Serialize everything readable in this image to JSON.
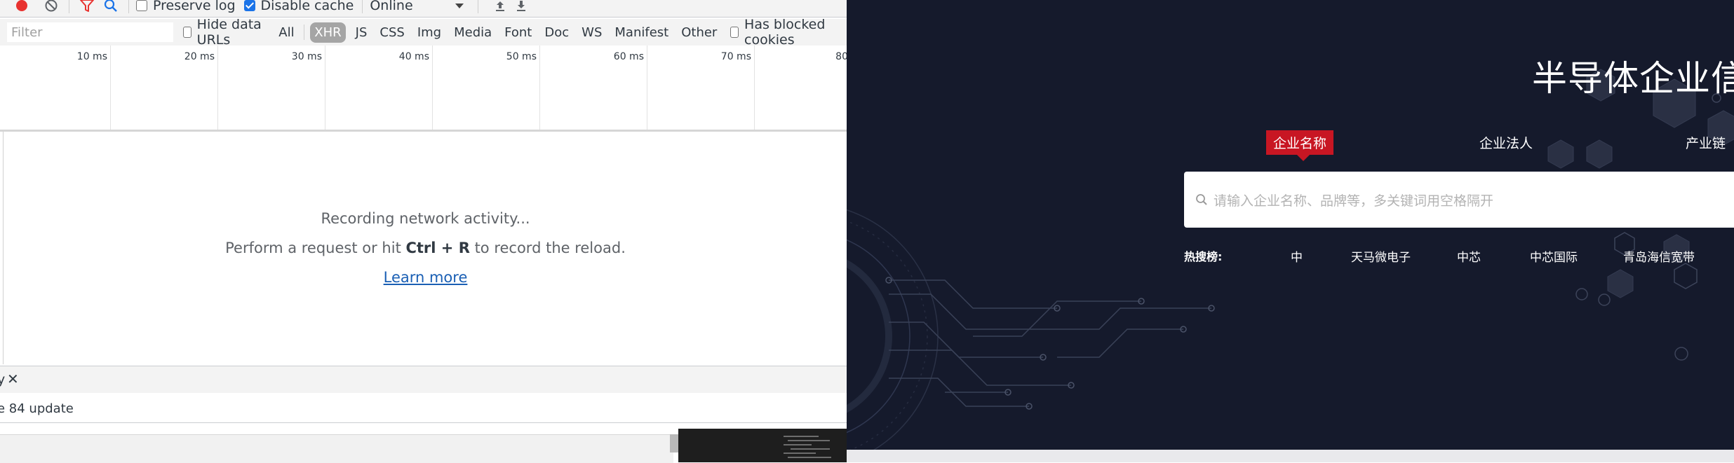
{
  "devtools": {
    "toolbar": {
      "preserve_log_label": "Preserve log",
      "preserve_log_checked": false,
      "disable_cache_label": "Disable cache",
      "disable_cache_checked": true,
      "throttling_value": "Online"
    },
    "filterbar": {
      "filter_placeholder": "Filter",
      "hide_data_urls_label": "Hide data URLs",
      "all_label": "All",
      "types": [
        "XHR",
        "JS",
        "CSS",
        "Img",
        "Media",
        "Font",
        "Doc",
        "WS",
        "Manifest",
        "Other"
      ],
      "active_type": "XHR",
      "has_blocked_cookies_label": "Has blocked cookies"
    },
    "timeline": {
      "ticks": [
        "10 ms",
        "20 ms",
        "30 ms",
        "40 ms",
        "50 ms",
        "60 ms",
        "70 ms",
        "80"
      ]
    },
    "empty_state": {
      "recording": "Recording network activity...",
      "instruction_before": "Perform a request or hit ",
      "shortcut": "Ctrl + R",
      "instruction_after": " to record the reload.",
      "learn_more": "Learn more"
    },
    "drawer": {
      "tab_label": "y",
      "close_glyph": "✕",
      "content": "e 84 update"
    }
  },
  "site": {
    "title": "半导体企业信",
    "tabs": [
      "企业名称",
      "企业法人",
      "产业链"
    ],
    "active_tab": "企业名称",
    "search_placeholder": "请输入企业名称、品牌等，多关键词用空格隔开",
    "hot_label": "热搜榜:",
    "hot_items": [
      "中",
      "天马微电子",
      "中芯",
      "中芯国际",
      "青岛海信宽带"
    ],
    "colors": {
      "background": "#151a2c",
      "accent": "#c81623"
    }
  }
}
